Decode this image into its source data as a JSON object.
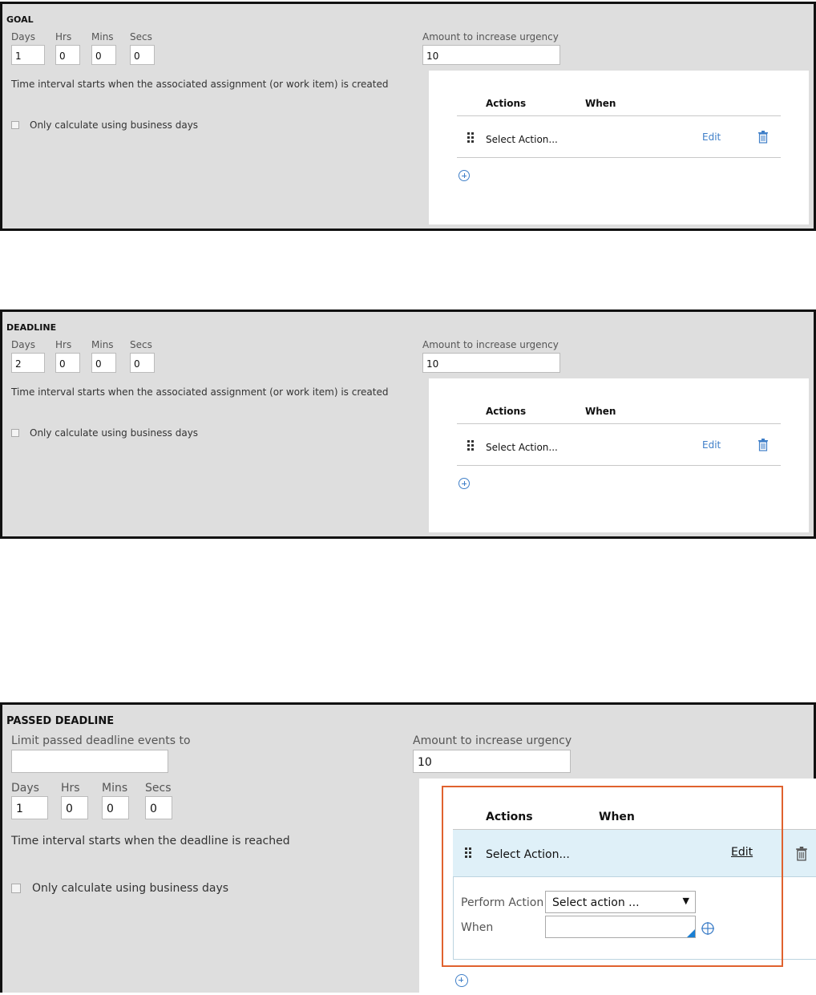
{
  "goal": {
    "title": "GOAL",
    "days_label": "Days",
    "hrs_label": "Hrs",
    "mins_label": "Mins",
    "secs_label": "Secs",
    "days": "1",
    "hrs": "0",
    "mins": "0",
    "secs": "0",
    "urgency_label": "Amount to increase urgency",
    "urgency": "10",
    "interval_text": "Time interval starts when the associated assignment (or work item) is created",
    "business_days_label": "Only calculate using business days",
    "actions_header": "Actions",
    "when_header": "When",
    "row_action": "Select Action...",
    "edit_label": "Edit"
  },
  "deadline": {
    "title": "DEADLINE",
    "days_label": "Days",
    "hrs_label": "Hrs",
    "mins_label": "Mins",
    "secs_label": "Secs",
    "days": "2",
    "hrs": "0",
    "mins": "0",
    "secs": "0",
    "urgency_label": "Amount to increase urgency",
    "urgency": "10",
    "interval_text": "Time interval starts when the associated assignment (or work item) is created",
    "business_days_label": "Only calculate using business days",
    "actions_header": "Actions",
    "when_header": "When",
    "row_action": "Select Action...",
    "edit_label": "Edit"
  },
  "passed": {
    "title": "PASSED DEADLINE",
    "limit_label": "Limit passed deadline events to",
    "limit_value": "",
    "urgency_label": "Amount to increase urgency",
    "urgency": "10",
    "days_label": "Days",
    "hrs_label": "Hrs",
    "mins_label": "Mins",
    "secs_label": "Secs",
    "days": "1",
    "hrs": "0",
    "mins": "0",
    "secs": "0",
    "interval_text": "Time interval starts when the deadline is reached",
    "business_days_label": "Only calculate using business days",
    "actions_header": "Actions",
    "when_header": "When",
    "row_action": "Select Action...",
    "edit_label": "Edit",
    "perform_action_label": "Perform Action",
    "perform_action_value": "Select action ...",
    "when_label": "When",
    "when_value": ""
  },
  "colors": {
    "highlight_border": "#e0622e",
    "link": "#3f7fc8",
    "row_selected": "#dff0f8"
  }
}
